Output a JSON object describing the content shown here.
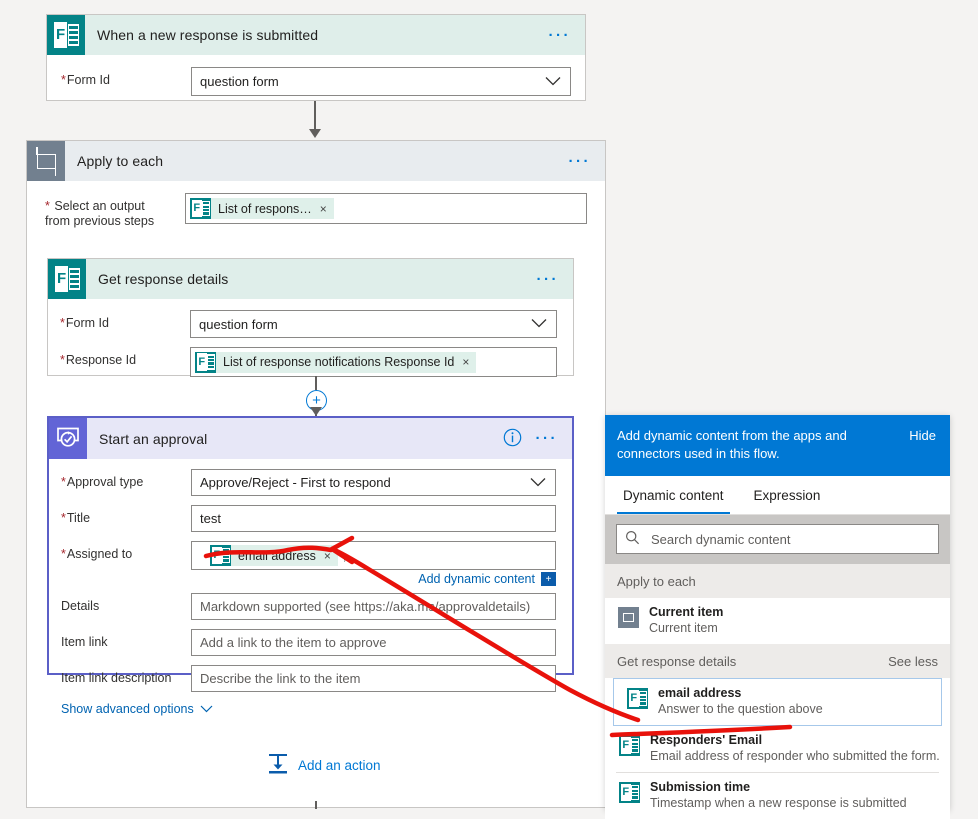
{
  "trigger": {
    "title": "When a new response is submitted",
    "icon": "forms-icon",
    "menu": "···",
    "fields": [
      {
        "label": "Form Id",
        "required": true,
        "value": "question form",
        "type": "dropdown"
      }
    ]
  },
  "loop": {
    "title": "Apply to each",
    "icon": "loop-icon",
    "menu": "···",
    "field_label_line1": "Select an output",
    "field_label_line2": "from previous steps",
    "token": {
      "text": "List of respons…",
      "remove": "×",
      "icon": "forms-icon"
    }
  },
  "get_response": {
    "title": "Get response details",
    "icon": "forms-icon",
    "menu": "···",
    "fields": [
      {
        "label": "Form Id",
        "required": true,
        "value": "question form",
        "type": "dropdown"
      },
      {
        "label": "Response Id",
        "required": true,
        "token": "List of response notifications Response Id",
        "remove": "×",
        "type": "token"
      }
    ]
  },
  "approval": {
    "title": "Start an approval",
    "icon": "approval-icon",
    "info": "i",
    "menu": "···",
    "selected_border_color": "#5b5fc7",
    "header_bg": "#e7e7f7",
    "fields": [
      {
        "label": "Approval type",
        "required": true,
        "value": "Approve/Reject - First to respond",
        "type": "dropdown"
      },
      {
        "label": "Title",
        "required": true,
        "value": "test",
        "type": "text"
      },
      {
        "label": "Assigned to",
        "required": true,
        "token": "email address",
        "remove": "×",
        "trailing": ";",
        "type": "token"
      },
      {
        "label": "Details",
        "required": false,
        "placeholder": "Markdown supported (see https://aka.ms/approvaldetails)",
        "type": "text"
      },
      {
        "label": "Item link",
        "required": false,
        "placeholder": "Add a link to the item to approve",
        "type": "text"
      },
      {
        "label": "Item link description",
        "required": false,
        "placeholder": "Describe the link to the item",
        "type": "text"
      }
    ],
    "add_dynamic_content": "Add dynamic content",
    "add_dynamic_icon": "+",
    "show_advanced": "Show advanced options"
  },
  "add_action": {
    "label": "Add an action",
    "icon": "add-action-icon"
  },
  "dynamic_panel": {
    "banner": "Add dynamic content from the apps and connectors used in this flow.",
    "hide": "Hide",
    "tabs": [
      {
        "label": "Dynamic content",
        "selected": true
      },
      {
        "label": "Expression",
        "selected": false
      }
    ],
    "search_placeholder": "Search dynamic content",
    "search_icon": "search-icon",
    "groups": [
      {
        "name": "Apply to each",
        "action": "",
        "items": [
          {
            "title": "Current item",
            "desc": "Current item",
            "icon": "loop-icon",
            "selected": false
          }
        ]
      },
      {
        "name": "Get response details",
        "action": "See less",
        "items": [
          {
            "title": "email address",
            "desc": "Answer to the question above",
            "icon": "forms-icon",
            "selected": true
          },
          {
            "title": "Responders' Email",
            "desc": "Email address of responder who submitted the form.",
            "icon": "forms-icon",
            "selected": false
          },
          {
            "title": "Submission time",
            "desc": "Timestamp when a new response is submitted",
            "icon": "forms-icon",
            "selected": false
          }
        ]
      }
    ]
  },
  "annotation": {
    "color": "#e8120b",
    "type": "hand-drawn-arrow"
  }
}
